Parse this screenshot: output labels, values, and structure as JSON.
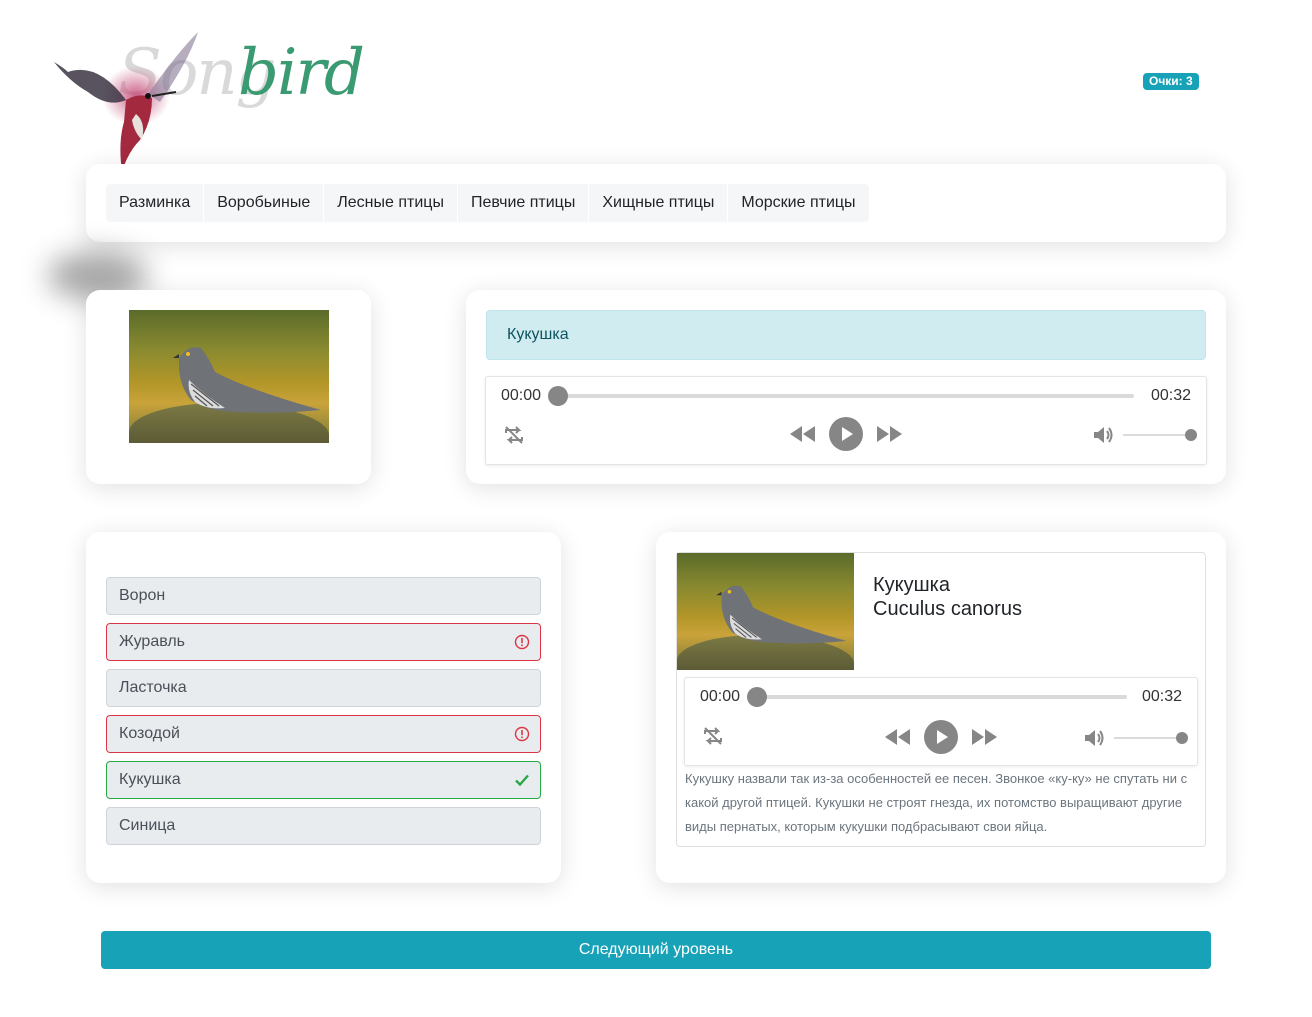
{
  "header": {
    "logo_part1": "Song",
    "logo_part2": "bird",
    "score": "Очки: 3"
  },
  "nav": {
    "items": [
      {
        "label": "Разминка"
      },
      {
        "label": "Воробьиные"
      },
      {
        "label": "Лесные птицы"
      },
      {
        "label": "Певчие птицы"
      },
      {
        "label": "Хищные птицы"
      },
      {
        "label": "Морские птицы"
      }
    ]
  },
  "question": {
    "bird_name": "Кукушка",
    "player": {
      "current_time": "00:00",
      "duration": "00:32",
      "progress": 0,
      "volume": 1.0
    }
  },
  "answers": [
    {
      "label": "Ворон",
      "status": "none"
    },
    {
      "label": "Журавль",
      "status": "wrong"
    },
    {
      "label": "Ласточка",
      "status": "none"
    },
    {
      "label": "Козодой",
      "status": "wrong"
    },
    {
      "label": "Кукушка",
      "status": "correct"
    },
    {
      "label": "Синица",
      "status": "none"
    }
  ],
  "info": {
    "name": "Кукушка",
    "latin": "Cuculus canorus",
    "description": "Кукушку назвали так из-за особенностей ее песен. Звонкое «ку-ку» не спутать ни с какой другой птицей. Кукушки не строят гнезда, их потомство выращивают другие виды пернатых, которым кукушки подбрасывают свои яйца.",
    "player": {
      "current_time": "00:00",
      "duration": "00:32",
      "progress": 0,
      "volume": 1.0
    }
  },
  "next_button": "Следующий уровень",
  "colors": {
    "accent": "#17a2b8",
    "logo_green": "#3a9a72",
    "wrong": "#dc3545",
    "correct": "#28a745",
    "alert_info_bg": "#d1ecf1"
  }
}
